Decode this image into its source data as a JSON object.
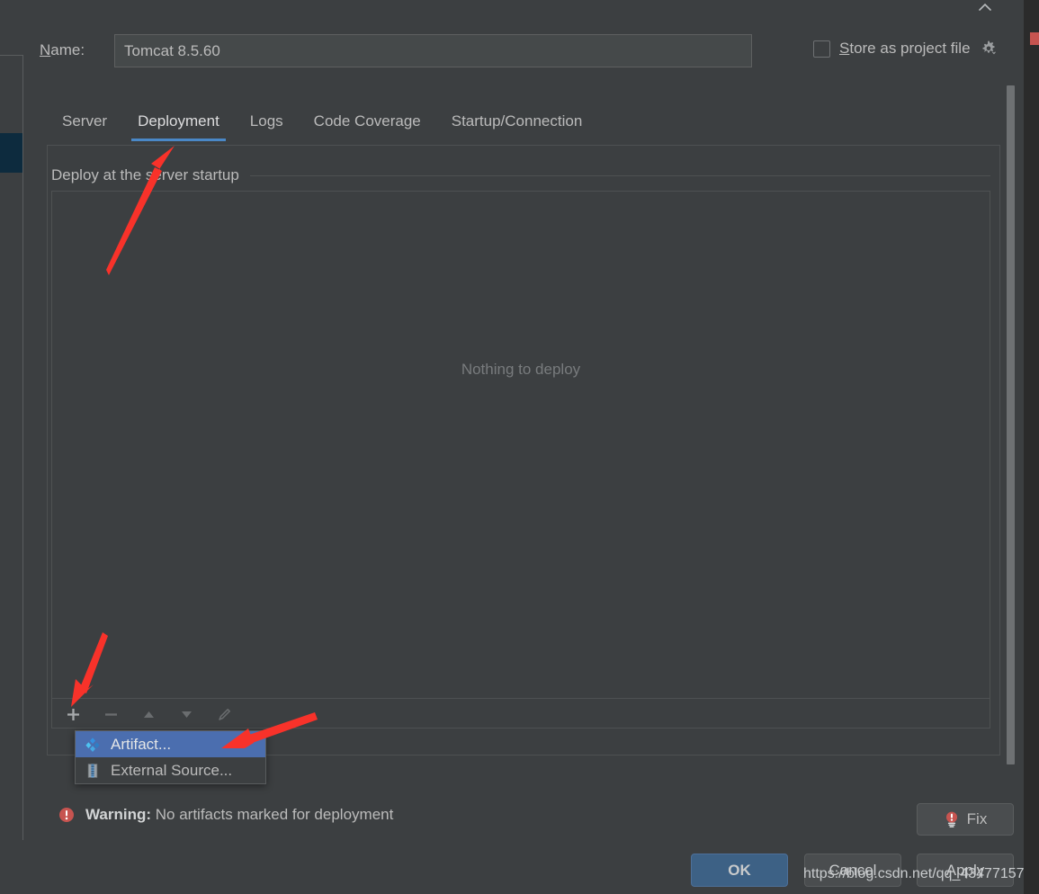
{
  "window": {
    "close_icon": "close-icon"
  },
  "name_row": {
    "label_prefix": "N",
    "label_rest": "ame:",
    "value": "Tomcat 8.5.60",
    "placeholder": "Name",
    "store_checkbox": {
      "checked": false,
      "label_prefix": "S",
      "label_rest": "tore as project file",
      "gear_icon": "gear-icon"
    }
  },
  "tabs": [
    {
      "label": "Server",
      "active": false
    },
    {
      "label": "Deployment",
      "active": true
    },
    {
      "label": "Logs",
      "active": false
    },
    {
      "label": "Code Coverage",
      "active": false
    },
    {
      "label": "Startup/Connection",
      "active": false
    }
  ],
  "deployment": {
    "group_title": "Deploy at the server startup",
    "empty_text": "Nothing to deploy",
    "toolbar": [
      {
        "name": "add-button",
        "glyph": "+",
        "enabled": true
      },
      {
        "name": "remove-button",
        "glyph": "−",
        "enabled": false
      },
      {
        "name": "move-up-button",
        "glyph": "▲",
        "enabled": false
      },
      {
        "name": "move-down-button",
        "glyph": "▼",
        "enabled": false
      },
      {
        "name": "edit-button",
        "glyph": "✎",
        "enabled": false
      }
    ],
    "popup_menu": [
      {
        "label": "Artifact...",
        "icon": "artifact-icon",
        "selected": true
      },
      {
        "label": "External Source...",
        "icon": "external-source-icon",
        "selected": false
      }
    ]
  },
  "warning": {
    "icon": "error-circle-icon",
    "prefix": "Warning:",
    "message": "No artifacts marked for deployment",
    "fix_button": {
      "label": "Fix",
      "icon": "lightbulb-error-icon"
    }
  },
  "footer": {
    "ok": "OK",
    "cancel": "Cancel",
    "apply": "Apply"
  },
  "watermark": "https://blog.csdn.net/qq_43477157",
  "colors": {
    "dialog_bg": "#3c3f41",
    "input_bg": "#45494a",
    "accent_blue": "#4a88c7",
    "menu_selection": "#4b6eaf",
    "ok_button": "#3d6185",
    "warning_red": "#c75450",
    "arrow_red": "#f8322a",
    "text": "#bbbbbb"
  }
}
